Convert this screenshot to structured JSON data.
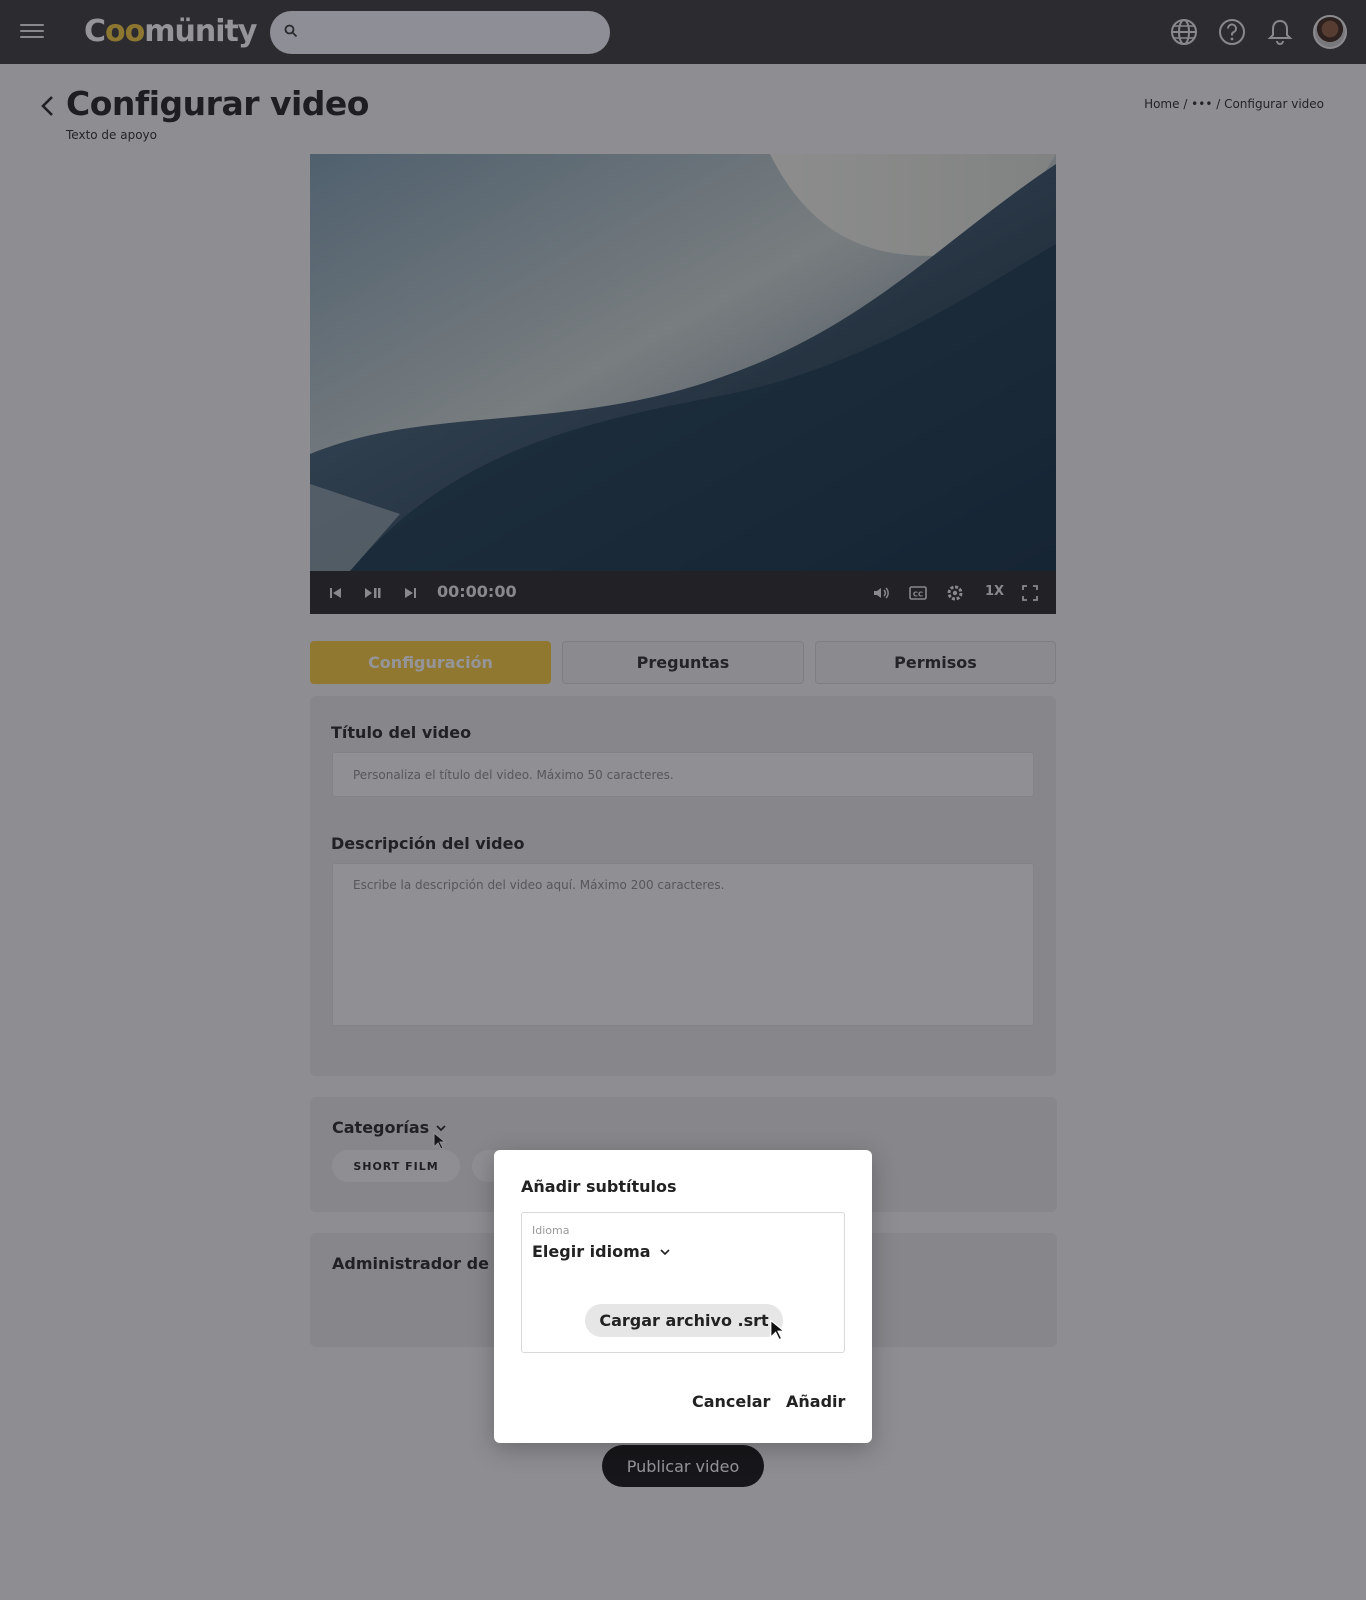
{
  "app": {
    "logo_text": "Coomünity",
    "search": {
      "placeholder": ""
    }
  },
  "header": {
    "title": "Configurar video",
    "subtitle": "Texto de apoyo",
    "breadcrumb": "Home / ••• / Configurar video"
  },
  "player": {
    "timecode": "00:00:00",
    "speed": "1X"
  },
  "tabs": [
    {
      "label": "Configuración",
      "active": true
    },
    {
      "label": "Preguntas",
      "active": false
    },
    {
      "label": "Permisos",
      "active": false
    }
  ],
  "form": {
    "title_label": "Título del video",
    "title_placeholder": "Personaliza el título del video. Máximo 50 caracteres.",
    "desc_label": "Descripción del video",
    "desc_placeholder": "Escribe la descripción del video aquí. Máximo 200 caracteres."
  },
  "categories": {
    "label": "Categorías",
    "chips": [
      "SHORT FILM"
    ]
  },
  "subtitles_admin": {
    "label": "Administrador de su"
  },
  "publish_label": "Publicar video",
  "modal": {
    "title": "Añadir subtítulos",
    "language_label": "Idioma",
    "language_value": "Elegir idioma",
    "upload_label": "Cargar archivo .srt",
    "cancel_label": "Cancelar",
    "add_label": "Añadir"
  },
  "colors": {
    "accent": "#f6c93a",
    "topbar": "#3a3a3a"
  }
}
